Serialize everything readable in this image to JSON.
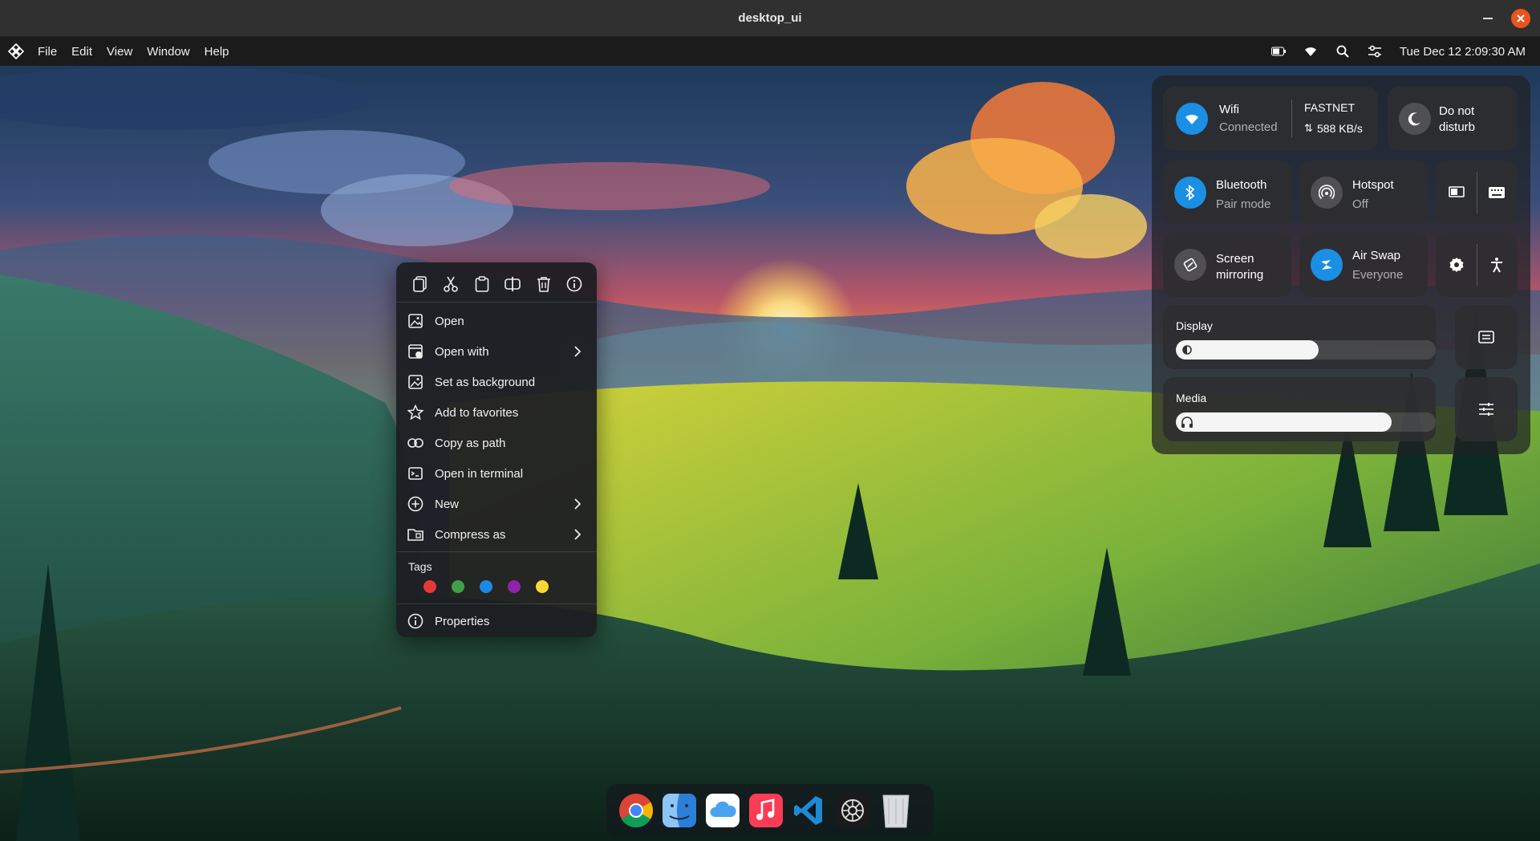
{
  "window": {
    "title": "desktop_ui"
  },
  "menubar": {
    "items": [
      "File",
      "Edit",
      "View",
      "Window",
      "Help"
    ],
    "clock": "Tue Dec 12 2:09:30 AM"
  },
  "context_menu": {
    "toolbar": [
      "copy-icon",
      "cut-icon",
      "paste-icon",
      "rename-icon",
      "delete-icon",
      "info-icon"
    ],
    "items": [
      {
        "label": "Open",
        "icon": "image-icon",
        "submenu": false
      },
      {
        "label": "Open with",
        "icon": "open-with-icon",
        "submenu": true
      },
      {
        "label": "Set as background",
        "icon": "wallpaper-icon",
        "submenu": false
      },
      {
        "label": "Add to favorites",
        "icon": "star-icon",
        "submenu": false
      },
      {
        "label": "Copy as path",
        "icon": "link-icon",
        "submenu": false
      },
      {
        "label": "Open in terminal",
        "icon": "terminal-icon",
        "submenu": false
      },
      {
        "label": "New",
        "icon": "plus-circle-icon",
        "submenu": true
      },
      {
        "label": "Compress as",
        "icon": "archive-icon",
        "submenu": true
      }
    ],
    "tags_label": "Tags",
    "tag_colors": [
      "#e53935",
      "#43a047",
      "#1e88e5",
      "#8e24aa",
      "#fdd835"
    ],
    "properties_label": "Properties"
  },
  "quick_settings": {
    "wifi": {
      "title": "Wifi",
      "status": "Connected",
      "network": "FASTNET",
      "speed": "588 KB/s",
      "enabled": true
    },
    "dnd": {
      "title": "Do not",
      "title2": "disturb"
    },
    "bluetooth": {
      "title": "Bluetooth",
      "status": "Pair mode",
      "enabled": true
    },
    "hotspot": {
      "title": "Hotspot",
      "status": "Off",
      "enabled": false
    },
    "screen_mirroring": {
      "title": "Screen",
      "title2": "mirroring"
    },
    "air_swap": {
      "title": "Air Swap",
      "status": "Everyone",
      "enabled": true
    },
    "display": {
      "label": "Display",
      "level": 0.55
    },
    "media": {
      "label": "Media",
      "level": 0.83
    }
  },
  "dock": {
    "apps": [
      "Chrome",
      "Finder",
      "iCloud",
      "Music",
      "VS Code",
      "Settings",
      "Trash"
    ]
  },
  "colors": {
    "accent": "#1a8fe3",
    "close": "#e95420"
  }
}
